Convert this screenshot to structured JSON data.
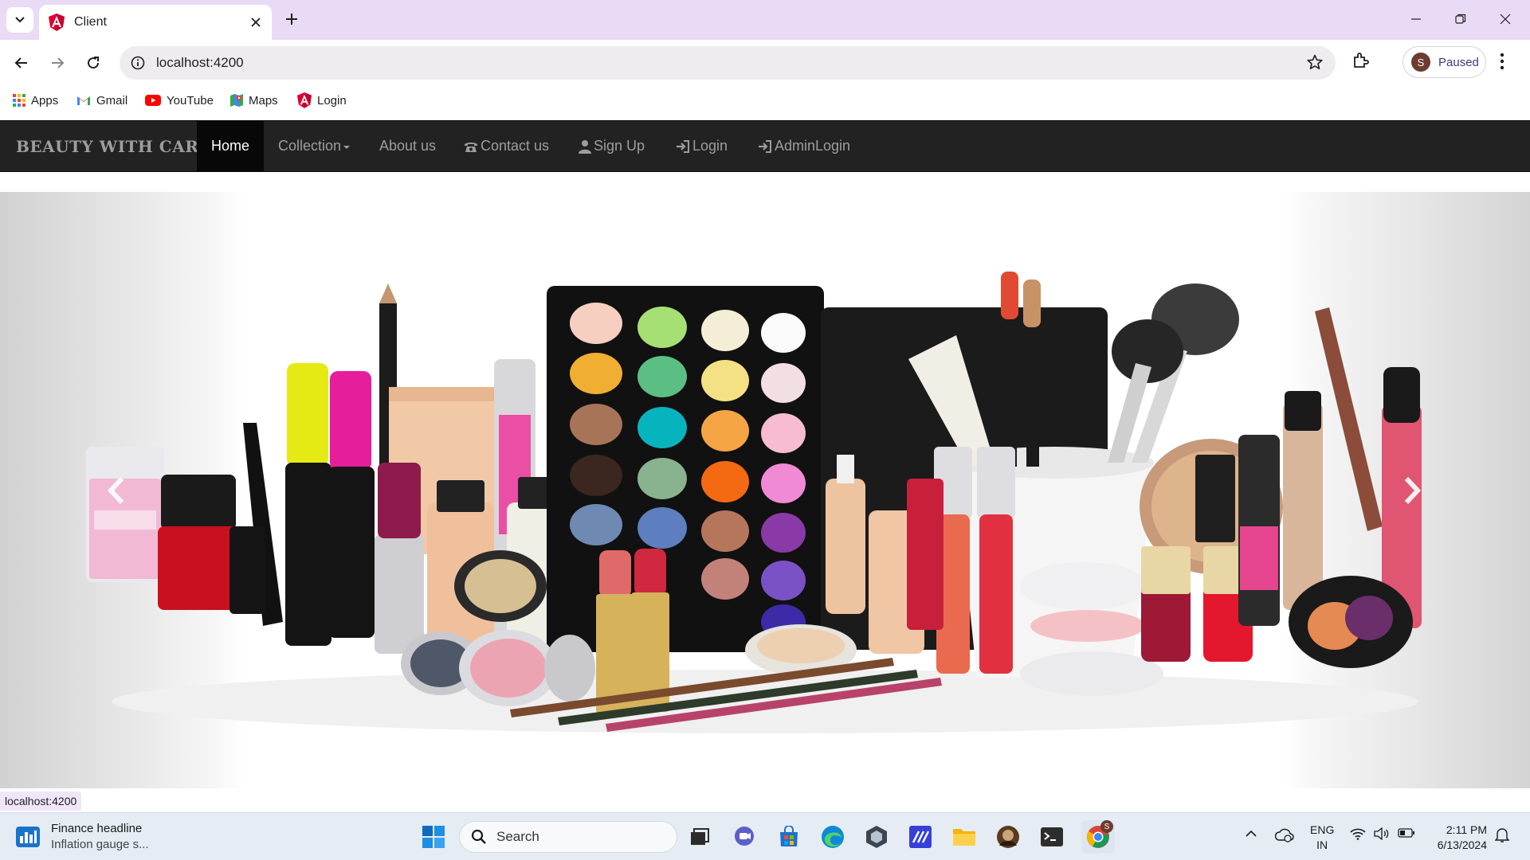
{
  "browser": {
    "tab_title": "Client",
    "url": "localhost:4200",
    "profile_initial": "S",
    "profile_status": "Paused",
    "status_url": "localhost:4200",
    "bookmarks": [
      {
        "label": "Apps",
        "icon": "apps-grid-icon"
      },
      {
        "label": "Gmail",
        "icon": "gmail-icon"
      },
      {
        "label": "YouTube",
        "icon": "youtube-icon"
      },
      {
        "label": "Maps",
        "icon": "maps-icon"
      },
      {
        "label": "Login",
        "icon": "angular-icon"
      }
    ]
  },
  "site": {
    "brand": "BEAUTY WITH CARE",
    "nav": [
      {
        "label": "Home",
        "active": true
      },
      {
        "label": "Collection",
        "dropdown": true
      },
      {
        "label": "About us"
      },
      {
        "label": "Contact us",
        "icon": "phone-icon"
      },
      {
        "label": "Sign Up",
        "icon": "user-icon"
      },
      {
        "label": "Login",
        "icon": "log-in-icon"
      },
      {
        "label": "AdminLogin",
        "icon": "log-in-icon"
      }
    ],
    "carousel": {
      "image": "cosmetics-banner",
      "prev_icon": "chevron-left-icon",
      "next_icon": "chevron-right-icon"
    }
  },
  "taskbar": {
    "news_title": "Finance headline",
    "news_subtitle": "Inflation gauge s...",
    "search_placeholder": "Search",
    "lang_line1": "ENG",
    "lang_line2": "IN",
    "time": "2:11 PM",
    "date": "6/13/2024",
    "chrome_badge": "S"
  },
  "colors": {
    "tabstrip": "#e9dbf5",
    "navbar": "#222222",
    "navbar_active": "#080808",
    "nav_text": "#9d9d9d"
  }
}
